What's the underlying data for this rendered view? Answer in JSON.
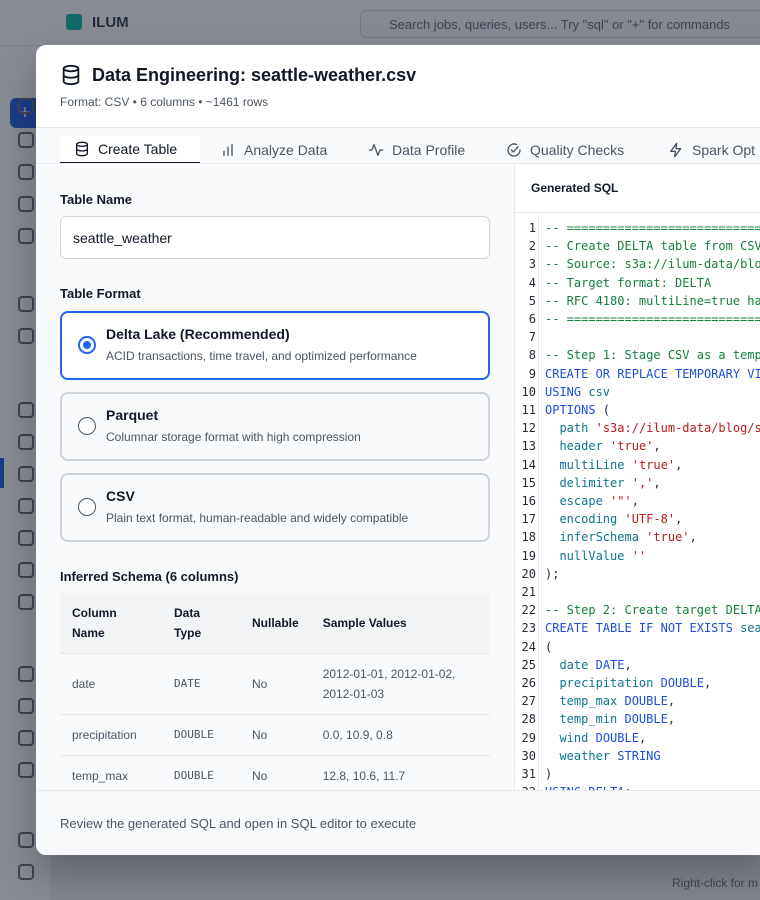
{
  "background": {
    "logo": "ILUM",
    "search_placeholder": "Search jobs, queries, users... Try \"sql\" or \"+\" for commands",
    "hint": "Right-click for m"
  },
  "modal": {
    "title": "Data Engineering: seattle-weather.csv",
    "subtitle": "Format: CSV • 6 columns • ~1461 rows",
    "tabs": [
      {
        "label": "Create Table",
        "icon": "database-icon",
        "active": true
      },
      {
        "label": "Analyze Data",
        "icon": "bar-chart-icon",
        "active": false
      },
      {
        "label": "Data Profile",
        "icon": "activity-icon",
        "active": false
      },
      {
        "label": "Quality Checks",
        "icon": "check-circle-icon",
        "active": false
      },
      {
        "label": "Spark Opt",
        "icon": "zap-icon",
        "active": false
      }
    ],
    "table_name": {
      "label": "Table Name",
      "value": "seattle_weather"
    },
    "table_format": {
      "label": "Table Format",
      "options": [
        {
          "title": "Delta Lake (Recommended)",
          "desc": "ACID transactions, time travel, and optimized performance",
          "selected": true
        },
        {
          "title": "Parquet",
          "desc": "Columnar storage format with high compression",
          "selected": false
        },
        {
          "title": "CSV",
          "desc": "Plain text format, human-readable and widely compatible",
          "selected": false
        }
      ]
    },
    "schema": {
      "label": "Inferred Schema (6 columns)",
      "headers": [
        "Column Name",
        "Data Type",
        "Nullable",
        "Sample Values"
      ],
      "rows": [
        [
          "date",
          "DATE",
          "No",
          "2012-01-01, 2012-01-02, 2012-01-03"
        ],
        [
          "precipitation",
          "DOUBLE",
          "No",
          "0.0, 10.9, 0.8"
        ],
        [
          "temp_max",
          "DOUBLE",
          "No",
          "12.8, 10.6, 11.7"
        ]
      ]
    },
    "sql": {
      "title": "Generated SQL",
      "lines": [
        [
          [
            "c-comment",
            "-- ==========================="
          ]
        ],
        [
          [
            "c-comment",
            "-- Create DELTA table from CSV"
          ]
        ],
        [
          [
            "c-comment",
            "-- Source: s3a://ilum-data/blo"
          ]
        ],
        [
          [
            "c-comment",
            "-- Target format: DELTA"
          ]
        ],
        [
          [
            "c-comment",
            "-- RFC 4180: multiLine=true ha"
          ]
        ],
        [
          [
            "c-comment",
            "-- ==========================="
          ]
        ],
        [],
        [
          [
            "c-comment",
            "-- Step 1: Stage CSV as a temp"
          ]
        ],
        [
          [
            "c-kw",
            "CREATE OR REPLACE TEMPORARY VI"
          ]
        ],
        [
          [
            "c-kw",
            "USING"
          ],
          [
            "",
            " "
          ],
          [
            "c-prop",
            "csv"
          ]
        ],
        [
          [
            "c-kw",
            "OPTIONS"
          ],
          [
            "",
            " ("
          ]
        ],
        [
          [
            "",
            "  "
          ],
          [
            "c-prop",
            "path"
          ],
          [
            "",
            " "
          ],
          [
            "c-str",
            "'s3a://ilum-data/blog/s"
          ]
        ],
        [
          [
            "",
            "  "
          ],
          [
            "c-prop",
            "header"
          ],
          [
            "",
            " "
          ],
          [
            "c-str",
            "'true'"
          ],
          [
            "",
            ","
          ]
        ],
        [
          [
            "",
            "  "
          ],
          [
            "c-prop",
            "multiLine"
          ],
          [
            "",
            " "
          ],
          [
            "c-str",
            "'true'"
          ],
          [
            "",
            ","
          ]
        ],
        [
          [
            "",
            "  "
          ],
          [
            "c-prop",
            "delimiter"
          ],
          [
            "",
            " "
          ],
          [
            "c-str",
            "','"
          ],
          [
            "",
            ","
          ]
        ],
        [
          [
            "",
            "  "
          ],
          [
            "c-prop",
            "escape"
          ],
          [
            "",
            " "
          ],
          [
            "c-str",
            "'\"'"
          ],
          [
            "",
            ","
          ]
        ],
        [
          [
            "",
            "  "
          ],
          [
            "c-prop",
            "encoding"
          ],
          [
            "",
            " "
          ],
          [
            "c-str",
            "'UTF-8'"
          ],
          [
            "",
            ","
          ]
        ],
        [
          [
            "",
            "  "
          ],
          [
            "c-prop",
            "inferSchema"
          ],
          [
            "",
            " "
          ],
          [
            "c-str",
            "'true'"
          ],
          [
            "",
            ","
          ]
        ],
        [
          [
            "",
            "  "
          ],
          [
            "c-prop",
            "nullValue"
          ],
          [
            "",
            " "
          ],
          [
            "c-str",
            "''"
          ]
        ],
        [
          [
            "",
            ");"
          ]
        ],
        [],
        [
          [
            "c-comment",
            "-- Step 2: Create target DELTA"
          ]
        ],
        [
          [
            "c-kw",
            "CREATE TABLE IF NOT EXISTS"
          ],
          [
            "",
            " "
          ],
          [
            "c-prop",
            "sea"
          ]
        ],
        [
          [
            "",
            "("
          ]
        ],
        [
          [
            "",
            "  "
          ],
          [
            "c-prop",
            "date"
          ],
          [
            "",
            " "
          ],
          [
            "c-kw",
            "DATE"
          ],
          [
            "",
            ","
          ]
        ],
        [
          [
            "",
            "  "
          ],
          [
            "c-prop",
            "precipitation"
          ],
          [
            "",
            " "
          ],
          [
            "c-kw",
            "DOUBLE"
          ],
          [
            "",
            ","
          ]
        ],
        [
          [
            "",
            "  "
          ],
          [
            "c-prop",
            "temp_max"
          ],
          [
            "",
            " "
          ],
          [
            "c-kw",
            "DOUBLE"
          ],
          [
            "",
            ","
          ]
        ],
        [
          [
            "",
            "  "
          ],
          [
            "c-prop",
            "temp_min"
          ],
          [
            "",
            " "
          ],
          [
            "c-kw",
            "DOUBLE"
          ],
          [
            "",
            ","
          ]
        ],
        [
          [
            "",
            "  "
          ],
          [
            "c-prop",
            "wind"
          ],
          [
            "",
            " "
          ],
          [
            "c-kw",
            "DOUBLE"
          ],
          [
            "",
            ","
          ]
        ],
        [
          [
            "",
            "  "
          ],
          [
            "c-prop",
            "weather"
          ],
          [
            "",
            " "
          ],
          [
            "c-kw",
            "STRING"
          ]
        ],
        [
          [
            "",
            ")"
          ]
        ],
        [
          [
            "c-kw",
            "USING DELTA"
          ],
          [
            "",
            ";"
          ]
        ]
      ]
    },
    "footer_text": "Review the generated SQL and open in SQL editor to execute"
  },
  "colors": {
    "accent": "#2563eb",
    "comment": "#15803d",
    "keyword": "#1d4ed8",
    "string": "#b91c1c"
  }
}
